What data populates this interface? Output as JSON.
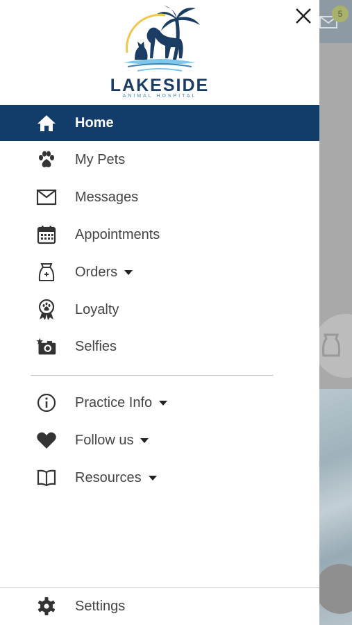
{
  "app": {
    "logo_name": "LAKESIDE",
    "logo_subtitle": "ANIMAL HOSPITAL"
  },
  "header": {
    "close_icon": "close-icon"
  },
  "menu": {
    "primary": [
      {
        "label": "Home",
        "icon": "home-icon",
        "active": true
      },
      {
        "label": "My Pets",
        "icon": "paw-icon"
      },
      {
        "label": "Messages",
        "icon": "mail-icon"
      },
      {
        "label": "Appointments",
        "icon": "calendar-icon"
      },
      {
        "label": "Orders",
        "icon": "bag-icon",
        "expandable": true
      },
      {
        "label": "Loyalty",
        "icon": "award-icon"
      },
      {
        "label": "Selfies",
        "icon": "camera-icon"
      }
    ],
    "secondary": [
      {
        "label": "Practice Info",
        "icon": "info-icon",
        "expandable": true
      },
      {
        "label": "Follow us",
        "icon": "heart-icon",
        "expandable": true
      },
      {
        "label": "Resources",
        "icon": "book-icon",
        "expandable": true
      }
    ],
    "footer": {
      "label": "Settings",
      "icon": "gear-icon"
    }
  },
  "background": {
    "message_badge_count": "5"
  },
  "colors": {
    "active_bg": "#123d6a",
    "text": "#444444",
    "brand_navy": "#1b3d63",
    "brand_blue": "#3a82b8"
  }
}
